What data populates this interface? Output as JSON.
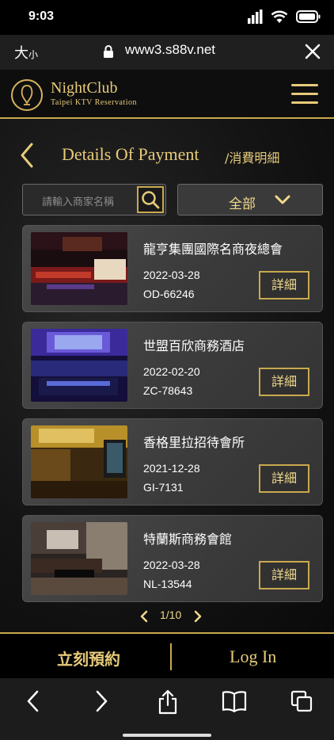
{
  "status_bar": {
    "time": "9:03"
  },
  "browser": {
    "text_size_label": "大",
    "text_size_small": "小",
    "url": "www3.s88v.net"
  },
  "header": {
    "logo_title": "NightClub",
    "logo_subtitle": "Taipei KTV Reservation"
  },
  "title_row": {
    "title": "Details Of Payment",
    "subtitle": "/消費明細"
  },
  "search": {
    "placeholder": "請輸入商家名稱"
  },
  "filter": {
    "label": "全部"
  },
  "cards": [
    {
      "name": "龍亨集團國際名商夜總會",
      "date": "2022-03-28",
      "code": "OD-66246",
      "button": "詳細"
    },
    {
      "name": "世盟百欣商務酒店",
      "date": "2022-02-20",
      "code": "ZC-78643",
      "button": "詳細"
    },
    {
      "name": "香格里拉招待會所",
      "date": "2021-12-28",
      "code": "GI-7131",
      "button": "詳細"
    },
    {
      "name": "特蘭斯商務會館",
      "date": "2022-03-28",
      "code": "NL-13544",
      "button": "詳細"
    }
  ],
  "pager": {
    "text": "1/10"
  },
  "bottom_bar": {
    "book_now": "立刻預約",
    "login": "Log In"
  },
  "colors": {
    "gold": "#e7cb7a",
    "gold_border": "#c9a94f",
    "background": "#0d0d0d"
  }
}
